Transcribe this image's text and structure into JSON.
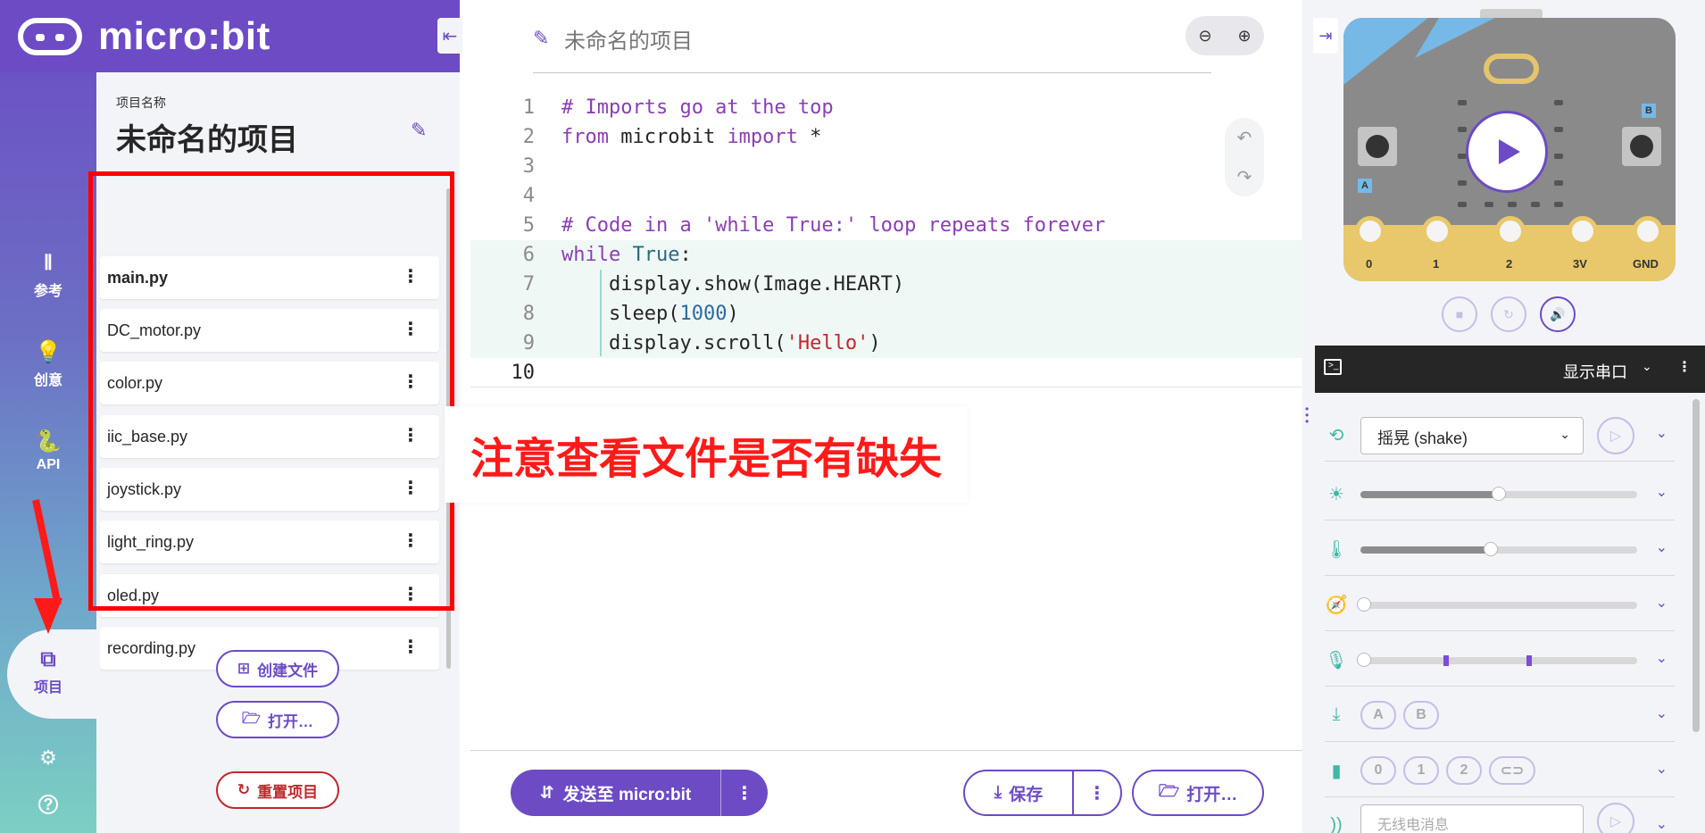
{
  "brand": {
    "name": "micro:bit"
  },
  "rail": {
    "items": [
      {
        "label": "参考",
        "icon": "books-icon"
      },
      {
        "label": "创意",
        "icon": "lightbulb-icon"
      },
      {
        "label": "API",
        "icon": "python-icon"
      },
      {
        "label": "项目",
        "icon": "files-icon"
      }
    ]
  },
  "files_panel": {
    "caption": "项目名称",
    "project_title": "未命名的项目",
    "files": [
      "main.py",
      "DC_motor.py",
      "color.py",
      "iic_base.py",
      "joystick.py",
      "light_ring.py",
      "oled.py",
      "recording.py"
    ],
    "create_file": "创建文件",
    "open": "打开…",
    "reset": "重置项目"
  },
  "editor": {
    "project_name": "未命名的项目",
    "line_numbers": [
      "1",
      "2",
      "3",
      "4",
      "5",
      "6",
      "7",
      "8",
      "9",
      "10"
    ],
    "lines": [
      "# Imports go at the top",
      "from microbit import *",
      "",
      "",
      "# Code in a 'while True:' loop repeats forever",
      "while True:",
      "    display.show(Image.HEART)",
      "    sleep(1000)",
      "    display.scroll('Hello')",
      ""
    ]
  },
  "annotation": "注意查看文件是否有缺失",
  "footer": {
    "send": "发送至 micro:bit",
    "save": "保存",
    "open": "打开…"
  },
  "simulator": {
    "pins": [
      "0",
      "1",
      "2",
      "3V",
      "GND"
    ],
    "button_a": "A",
    "button_b": "B",
    "serial_label": "显示串口",
    "gesture": "摇晃 (shake)",
    "light_level": 0.5,
    "temperature_level": 0.47,
    "compass_level": 0,
    "pill_buttons": [
      "A",
      "B"
    ],
    "pin_pills": [
      "0",
      "1",
      "2"
    ],
    "radio_placeholder": "无线电消息"
  },
  "colors": {
    "accent": "#6c4bc5",
    "annotation_red": "#ff1a1a",
    "sensor_teal": "#3fb8a6"
  }
}
